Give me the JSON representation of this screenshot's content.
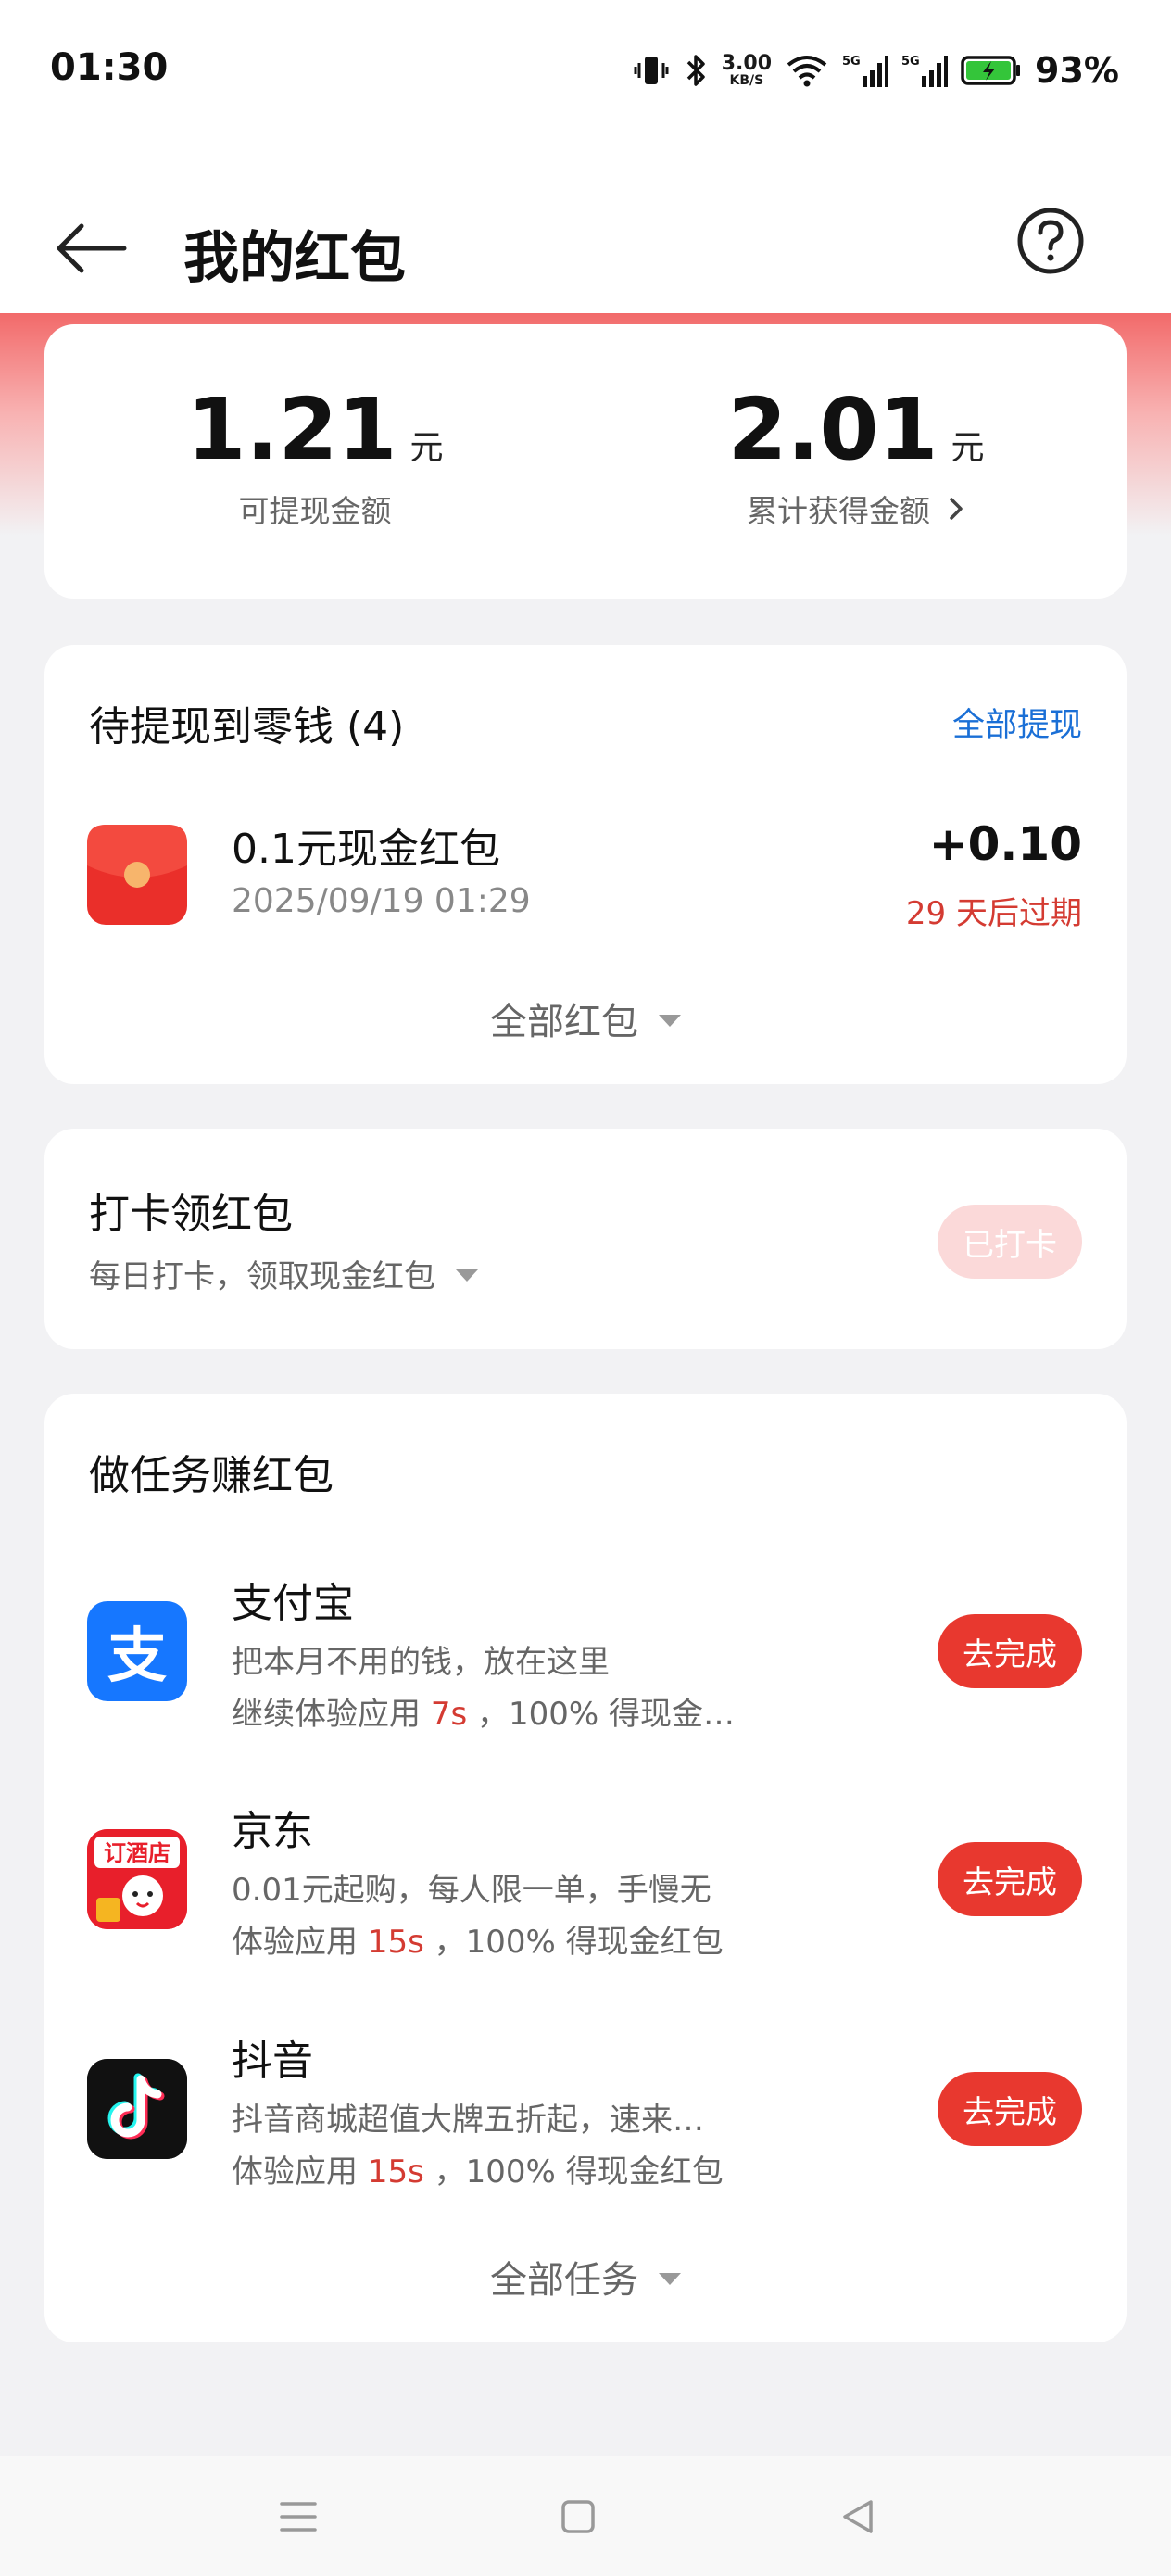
{
  "status_bar": {
    "time": "01:30",
    "net_speed_value": "3.00",
    "net_speed_unit": "KB/S",
    "signal1_label": "5G",
    "signal2_label": "5G",
    "battery_percent": "93%"
  },
  "header": {
    "title": "我的红包",
    "back_icon": "arrow-left-icon",
    "help_icon": "question-circle-icon"
  },
  "summary": {
    "withdrawable_amount": "1.21",
    "withdrawable_unit": "元",
    "withdrawable_label": "可提现金额",
    "total_amount": "2.01",
    "total_unit": "元",
    "total_label": "累计获得金额"
  },
  "pending": {
    "title": "待提现到零钱 (4)",
    "withdraw_all": "全部提现",
    "item": {
      "title": "0.1元现金红包",
      "time": "2025/09/19 01:29",
      "amount": "+0.10",
      "expire": "29 天后过期"
    },
    "expand_label": "全部红包"
  },
  "checkin": {
    "title": "打卡领红包",
    "subtitle": "每日打卡，领取现金红包",
    "button": "已打卡"
  },
  "tasks": {
    "title": "做任务赚红包",
    "button_label": "去完成",
    "items": [
      {
        "name": "支付宝",
        "desc": "把本月不用的钱，放在这里",
        "line_prefix": "继续体验应用",
        "seconds": "7s",
        "line_suffix": "，100% 得现金…",
        "icon": "alipay-icon",
        "icon_char": "支"
      },
      {
        "name": "京东",
        "desc": "0.01元起购，每人限一单，手慢无",
        "line_prefix": "体验应用",
        "seconds": "15s",
        "line_suffix": "，100% 得现金红包",
        "icon": "jd-hotel-icon",
        "icon_text": "订酒店"
      },
      {
        "name": "抖音",
        "desc": "抖音商城超值大牌五折起，速来…",
        "line_prefix": "体验应用",
        "seconds": "15s",
        "line_suffix": "，100% 得现金红包",
        "icon": "douyin-icon"
      }
    ],
    "expand_label": "全部任务"
  },
  "colors": {
    "accent_red": "#e8382f",
    "link_blue": "#1a6fd6",
    "expire_red": "#d43b32"
  }
}
